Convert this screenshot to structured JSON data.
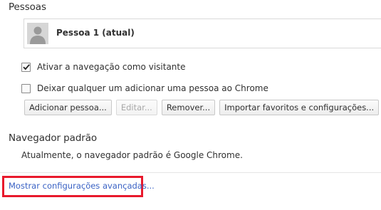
{
  "people": {
    "title": "Pessoas",
    "profiles": [
      {
        "name": "Pessoa 1 (atual)",
        "icon": "user-avatar-icon"
      }
    ],
    "options": [
      {
        "label": "Ativar a navegação como visitante",
        "checked": true
      },
      {
        "label": "Deixar qualquer um adicionar uma pessoa ao Chrome",
        "checked": false
      }
    ],
    "buttons": {
      "add": "Adicionar pessoa...",
      "edit": "Editar...",
      "remove": "Remover...",
      "import": "Importar favoritos e configurações..."
    }
  },
  "default_browser": {
    "title": "Navegador padrão",
    "status": "Atualmente, o navegador padrão é Google Chrome."
  },
  "advanced_link": "Mostrar configurações avançadas...",
  "colors": {
    "link": "#3a62c4",
    "highlight": "#e8192c"
  }
}
